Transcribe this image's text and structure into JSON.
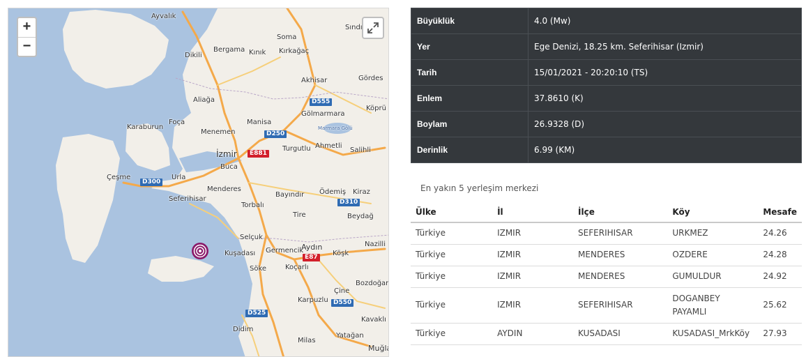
{
  "map": {
    "zoom_in": "+",
    "zoom_out": "−",
    "fullscreen_icon": "expand-icon",
    "marker_color": "#8a1a6a",
    "places": [
      "Ayvalık",
      "Sındırgı",
      "Dikili",
      "Bergama",
      "Kınık",
      "Soma",
      "Kırkağaç",
      "Akhisar",
      "Gördes",
      "Aliağa",
      "Gölmarmara",
      "Köprü",
      "Karaburun",
      "Foça",
      "Menemen",
      "Manisa",
      "Marmara Gölü",
      "Turgutlu",
      "Ahmetli",
      "Salihli",
      "İzmir",
      "Buca",
      "Çeşme",
      "Urla",
      "Menderes",
      "Seferihisar",
      "Bayındır",
      "Ödemiş",
      "Kiraz",
      "Torbalı",
      "Tire",
      "Beydağ",
      "Selçuk",
      "Aydın",
      "Germencik",
      "Köşk",
      "Nazilli",
      "Kuşadası",
      "Söke",
      "Koçarlı",
      "Bozdoğan",
      "Çine",
      "Karpuzlu",
      "Kavaklı",
      "Didim",
      "Yatağan",
      "Milas",
      "Muğla"
    ],
    "road_shields": [
      "D555",
      "D250",
      "E881",
      "D300",
      "D310",
      "E87",
      "D525",
      "D550"
    ]
  },
  "info": {
    "rows": [
      {
        "key": "Büyüklük",
        "value": "4.0 (Mw)"
      },
      {
        "key": "Yer",
        "value": "Ege Denizi, 18.25 km. Seferihisar (Izmir)"
      },
      {
        "key": "Tarih",
        "value": "15/01/2021 - 20:20:10 (TS)"
      },
      {
        "key": "Enlem",
        "value": "37.8610 (K)"
      },
      {
        "key": "Boylam",
        "value": "26.9328 (D)"
      },
      {
        "key": "Derinlik",
        "value": "6.99 (KM)"
      }
    ]
  },
  "settlements": {
    "caption": "En yakın 5 yerleşim merkezi",
    "headers": [
      "Ülke",
      "İl",
      "İlçe",
      "Köy",
      "Mesafe"
    ],
    "rows": [
      [
        "Türkiye",
        "IZMIR",
        "SEFERIHISAR",
        "URKMEZ",
        "24.26"
      ],
      [
        "Türkiye",
        "IZMIR",
        "MENDERES",
        "OZDERE",
        "24.28"
      ],
      [
        "Türkiye",
        "IZMIR",
        "MENDERES",
        "GUMULDUR",
        "24.92"
      ],
      [
        "Türkiye",
        "IZMIR",
        "SEFERIHISAR",
        "DOGANBEY PAYAMLI",
        "25.62"
      ],
      [
        "Türkiye",
        "AYDIN",
        "KUSADASI",
        "KUSADASI_MrkKöy",
        "27.93"
      ]
    ]
  }
}
